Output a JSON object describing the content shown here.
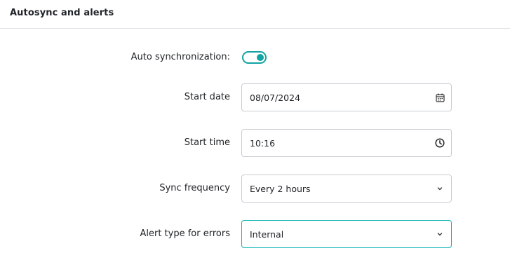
{
  "section": {
    "title": "Autosync and alerts"
  },
  "auto_sync": {
    "label": "Auto synchronization:",
    "enabled": true
  },
  "start_date": {
    "label": "Start date",
    "value": "08/07/2024",
    "icon": "calendar-icon"
  },
  "start_time": {
    "label": "Start time",
    "value": "10:16",
    "icon": "clock-icon"
  },
  "sync_frequency": {
    "label": "Sync frequency",
    "value": "Every 2 hours",
    "icon": "chevron-down-icon"
  },
  "alert_type": {
    "label": "Alert type for errors",
    "value": "Internal",
    "icon": "chevron-down-icon"
  },
  "colors": {
    "accent": "#12a3a3",
    "border": "#c8ccd1",
    "divider": "#dee2e6"
  }
}
